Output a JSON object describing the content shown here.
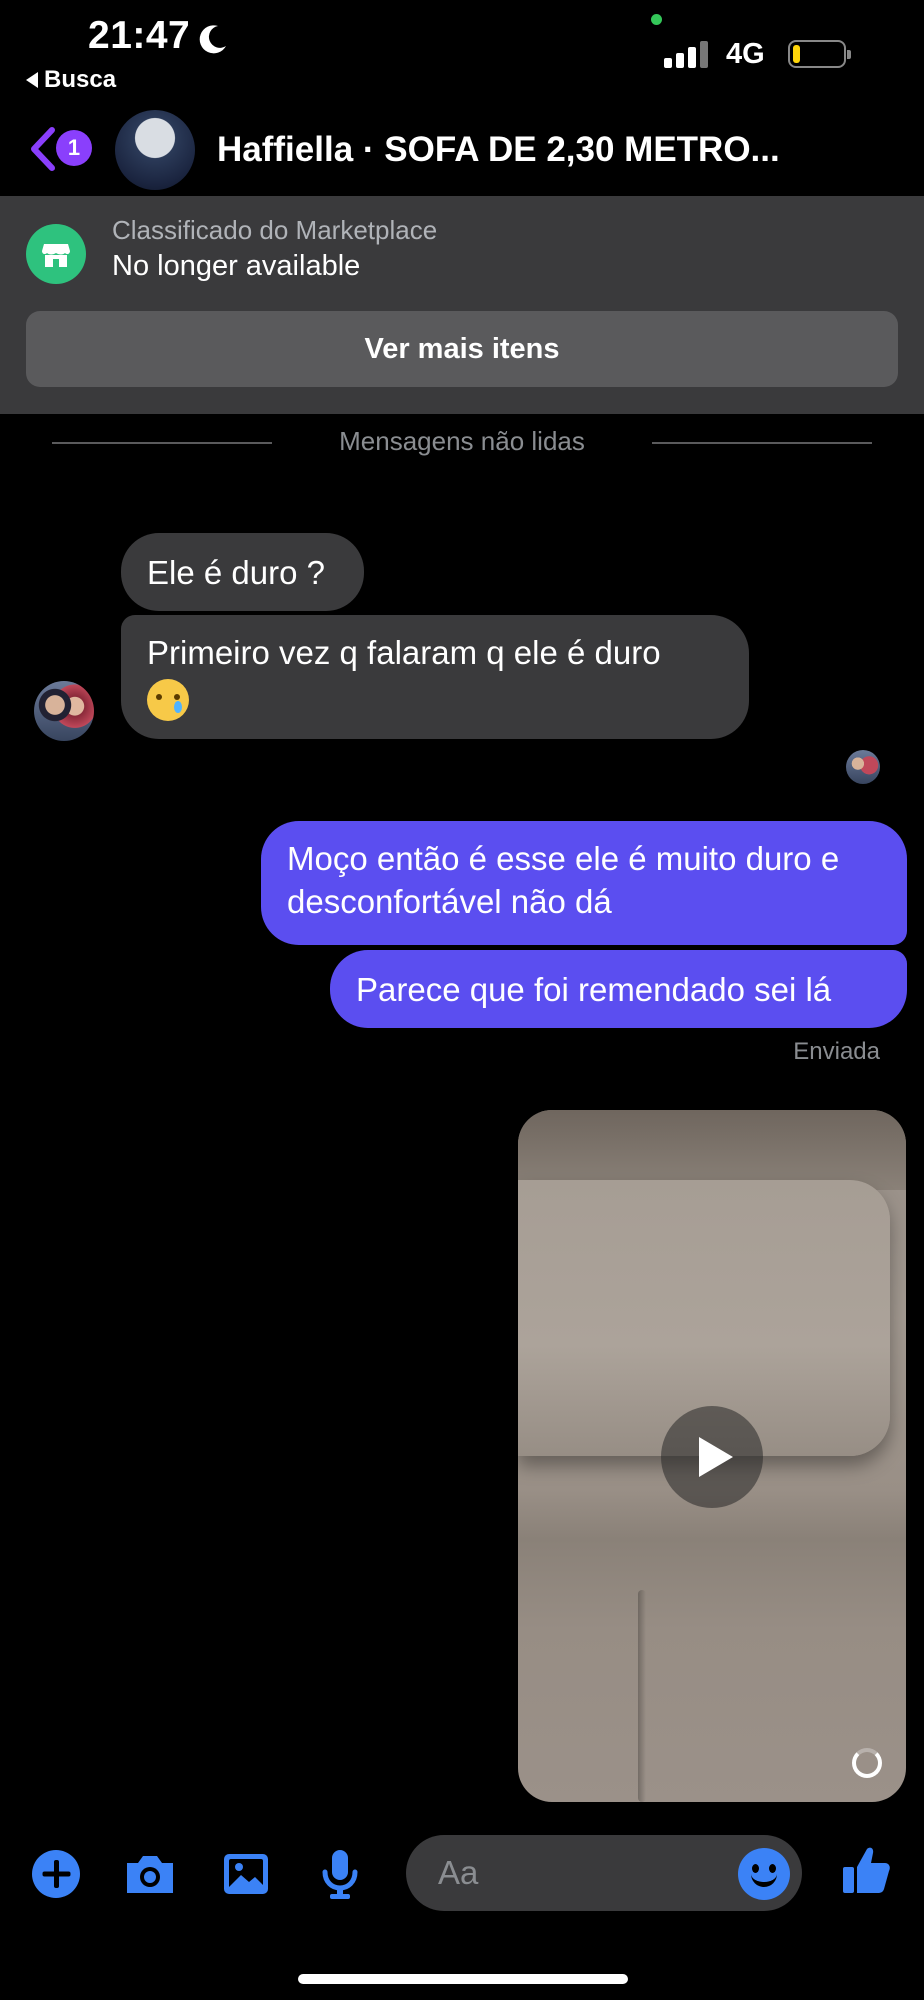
{
  "status_bar": {
    "time": "21:47",
    "back_app": "Busca",
    "network": "4G",
    "battery_level": 0.15
  },
  "header": {
    "unread_count": "1",
    "title": "Haffiella · SOFA DE 2,30 METRO..."
  },
  "listing": {
    "label": "Classificado do Marketplace",
    "status": "No longer available",
    "button": "Ver mais itens"
  },
  "separator": "Mensagens não lidas",
  "messages": {
    "incoming": [
      {
        "text": "Ele é duro ?"
      },
      {
        "text": "Primeiro vez q falaram q ele é duro",
        "emoji": "cry-emoji"
      }
    ],
    "outgoing": [
      {
        "text": "Moço então é esse ele é muito duro e desconfortável não dá"
      },
      {
        "text": "Parece que foi remendado sei lá"
      }
    ],
    "sent_status": "Enviada"
  },
  "composer": {
    "placeholder": "Aa"
  },
  "colors": {
    "outgoing_bubble": "#5b4ef0",
    "incoming_bubble": "#3a3a3c",
    "accent": "#3b82f6",
    "marketplace": "#2ec27e",
    "badge": "#8a3ffc"
  }
}
